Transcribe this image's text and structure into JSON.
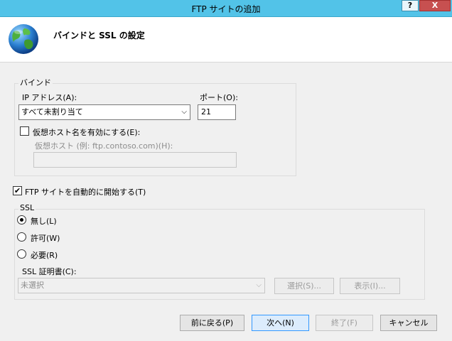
{
  "window": {
    "title": "FTP サイトの追加",
    "help_label": "?",
    "close_label": "X"
  },
  "header": {
    "title": "バインドと SSL の設定",
    "icon": "globe-icon"
  },
  "binding": {
    "group_label": "バインド",
    "ip_label": "IP アドレス(A):",
    "ip_value": "すべて未割り当て",
    "port_label": "ポート(O):",
    "port_value": "21",
    "virtual_host_checkbox_label": "仮想ホスト名を有効にする(E):",
    "virtual_host_checked": false,
    "virtual_host_label": "仮想ホスト (例: ftp.contoso.com)(H):",
    "virtual_host_value": ""
  },
  "autostart": {
    "label": "FTP サイトを自動的に開始する(T)",
    "checked": true,
    "check_glyph": "✔"
  },
  "ssl": {
    "group_label": "SSL",
    "options": [
      {
        "label": "無し(L)",
        "selected": true
      },
      {
        "label": "許可(W)",
        "selected": false
      },
      {
        "label": "必要(R)",
        "selected": false
      }
    ],
    "cert_label": "SSL 証明書(C):",
    "cert_value": "未選択",
    "select_button": "選択(S)...",
    "view_button": "表示(I)..."
  },
  "footer": {
    "back_button": "前に戻る(P)",
    "next_button": "次へ(N)",
    "finish_button": "終了(F)",
    "cancel_button": "キャンセル"
  },
  "colors": {
    "titlebar": "#52c3e8",
    "close_button": "#c75050",
    "primary_button_border": "#3399ff"
  }
}
